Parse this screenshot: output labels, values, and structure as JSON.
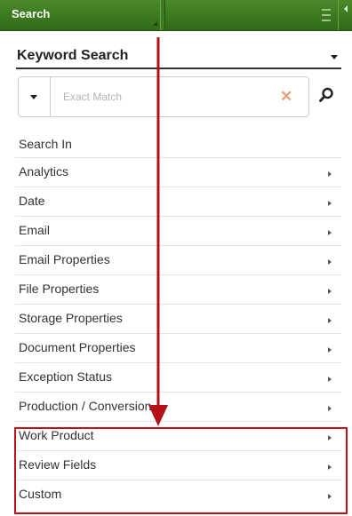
{
  "panel": {
    "title": "Search",
    "accent_color": "#3b7a1f",
    "menu_icon": "hamburger-icon",
    "collapse_icon": "caret-left-icon"
  },
  "keyword_search": {
    "label": "Keyword Search",
    "dropdown_icon": "caret-down-icon"
  },
  "search": {
    "placeholder": "Exact Match",
    "value": "",
    "mode_icon": "caret-down-icon",
    "clear_icon": "close-icon",
    "submit_icon": "search-icon"
  },
  "search_in": {
    "label": "Search In",
    "items": [
      {
        "label": "Analytics"
      },
      {
        "label": "Date"
      },
      {
        "label": "Email"
      },
      {
        "label": "Email Properties"
      },
      {
        "label": "File Properties"
      },
      {
        "label": "Storage Properties"
      },
      {
        "label": "Document Properties"
      },
      {
        "label": "Exception Status"
      },
      {
        "label": "Production / Conversion"
      },
      {
        "label": "Work Product"
      },
      {
        "label": "Review Fields"
      },
      {
        "label": "Custom"
      }
    ],
    "item_icon": "chevron-right-icon"
  },
  "annotation": {
    "arrow_color": "#b3121b",
    "highlight_color": "#c0111b",
    "highlighted_items": [
      "Work Product",
      "Review Fields",
      "Custom"
    ]
  }
}
